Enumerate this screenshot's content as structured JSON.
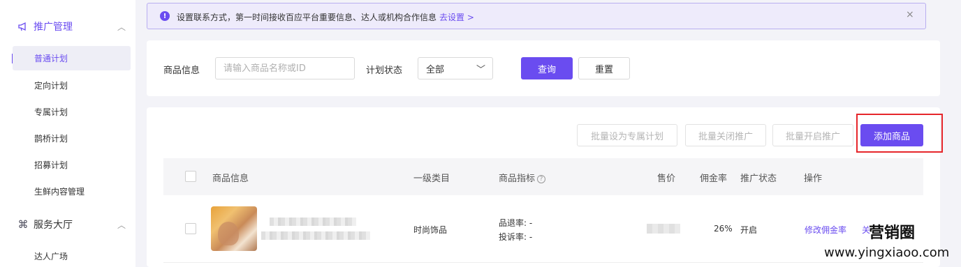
{
  "sidebar": {
    "sections": [
      {
        "label": "推广管理",
        "icon": "megaphone-icon"
      },
      {
        "label": "服务大厅",
        "icon": "command-icon"
      }
    ],
    "items": [
      {
        "label": "普通计划",
        "active": true
      },
      {
        "label": "定向计划"
      },
      {
        "label": "专属计划"
      },
      {
        "label": "鹊桥计划"
      },
      {
        "label": "招募计划"
      },
      {
        "label": "生鲜内容管理"
      },
      {
        "label": "达人广场"
      }
    ]
  },
  "notice": {
    "text": "设置联系方式，第一时间接收百应平台重要信息、达人或机构合作信息",
    "link": "去设置 >"
  },
  "filter": {
    "product_label": "商品信息",
    "product_placeholder": "请输入商品名称或ID",
    "status_label": "计划状态",
    "status_value": "全部",
    "query_button": "查询",
    "reset_button": "重置"
  },
  "actions": {
    "batch_exclusive": "批量设为专属计划",
    "batch_close": "批量关闭推广",
    "batch_open": "批量开启推广",
    "add_product": "添加商品"
  },
  "table": {
    "headers": {
      "product": "商品信息",
      "category": "一级类目",
      "metrics": "商品指标",
      "price": "售价",
      "commission": "佣金率",
      "status": "推广状态",
      "ops": "操作"
    },
    "rows": [
      {
        "category": "时尚饰品",
        "return_rate": "品退率: -",
        "complaint_rate": "投诉率: -",
        "commission": "26%",
        "status": "开启",
        "op_edit": "修改佣金率",
        "op_more": "关"
      }
    ]
  },
  "watermark": {
    "name": "营销圈",
    "url": "www.yingxiaoo.com"
  },
  "colors": {
    "accent": "#6a4cf0",
    "highlight_border": "#e6262b",
    "notice_bg": "#eeebfb"
  }
}
